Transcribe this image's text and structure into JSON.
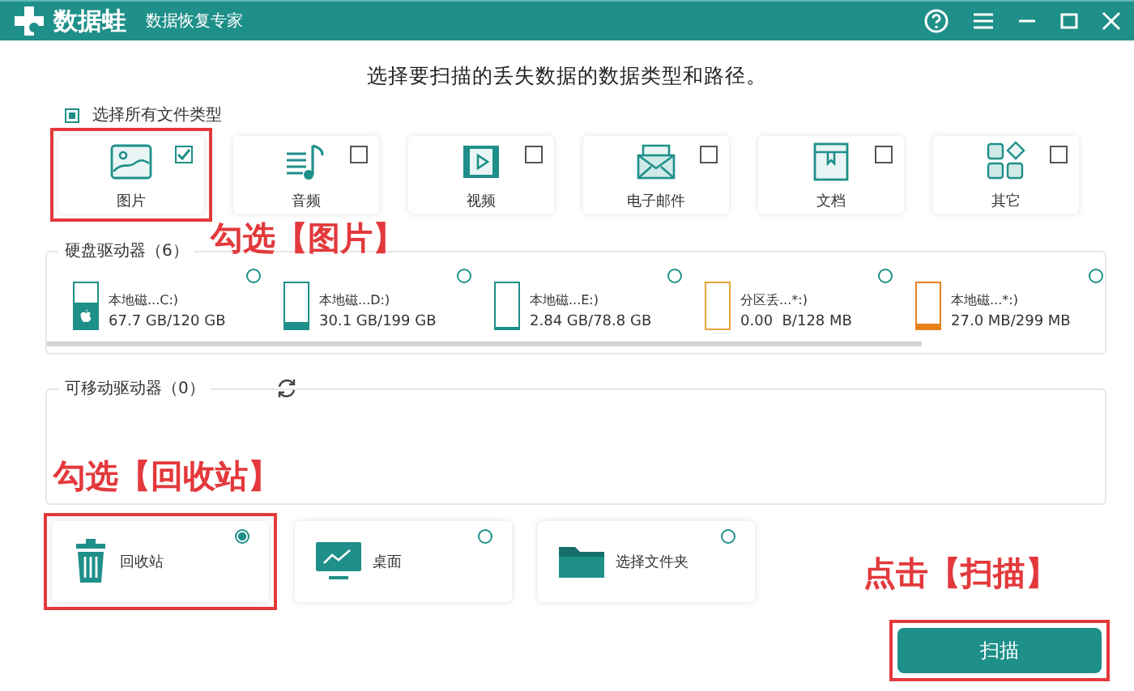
{
  "window": {
    "logo": "数据蛙",
    "subtitle": "数据恢复专家"
  },
  "heading": "选择要扫描的丢失数据的数据类型和路径。",
  "select_all": {
    "label": "选择所有文件类型",
    "checked": true
  },
  "file_types": [
    {
      "kind": "image",
      "label": "图片",
      "checked": true
    },
    {
      "kind": "audio",
      "label": "音频",
      "checked": false
    },
    {
      "kind": "video",
      "label": "视频",
      "checked": false
    },
    {
      "kind": "email",
      "label": "电子邮件",
      "checked": false
    },
    {
      "kind": "document",
      "label": "文档",
      "checked": false
    },
    {
      "kind": "other",
      "label": "其它",
      "checked": false
    }
  ],
  "hard_drives": {
    "label": "硬盘驱动器（6）",
    "drives": [
      {
        "name": "本地磁...C:)",
        "usage": "67.7 GB/120 GB",
        "level": 0.56,
        "color": "#1e8f89",
        "system": true,
        "selected": false
      },
      {
        "name": "本地磁...D:)",
        "usage": "30.1 GB/199 GB",
        "level": 0.15,
        "color": "#1e8f89",
        "system": false,
        "selected": false
      },
      {
        "name": "本地磁...E:)",
        "usage": "2.84 GB/78.8 GB",
        "level": 0.04,
        "color": "#1e8f89",
        "system": false,
        "selected": false
      },
      {
        "name": "分区丢...*:)",
        "usage": "0.00  B/128 MB",
        "level": 0,
        "color": "#e8a33c",
        "system": false,
        "selected": false
      },
      {
        "name": "本地磁...*:)",
        "usage": "27.0 MB/299 MB",
        "level": 0.09,
        "color": "#e8801c",
        "system": false,
        "selected": false
      }
    ]
  },
  "removable_drives": {
    "label": "可移动驱动器（0）"
  },
  "locations": [
    {
      "kind": "recycle",
      "label": "回收站",
      "selected": true
    },
    {
      "kind": "desktop",
      "label": "桌面",
      "selected": false
    },
    {
      "kind": "folder",
      "label": "选择文件夹",
      "selected": false
    }
  ],
  "scan_button": "扫描",
  "annotations": [
    "勾选【图片】",
    "勾选【回收站】",
    "点击【扫描】"
  ]
}
